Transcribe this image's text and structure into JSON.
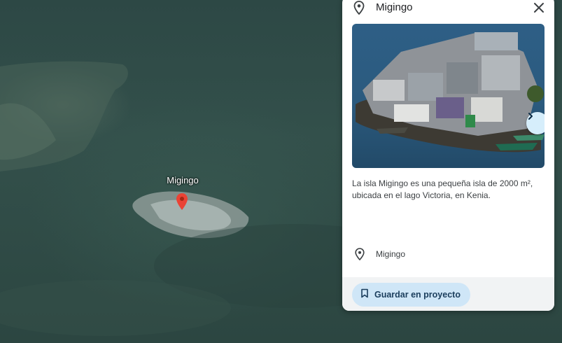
{
  "map": {
    "marker_label": "Migingo",
    "water_color": "#2f4a45"
  },
  "panel": {
    "title": "Migingo",
    "title_icon": "location-pin-icon",
    "close_icon": "close-icon",
    "photo_next_icon": "chevron-right-icon",
    "description": "La isla Migingo es una pequeña isla de 2000 m², ubicada en el lago Victoria, en Kenia.",
    "location_text": "Migingo",
    "save_button_label": "Guardar en proyecto",
    "save_icon": "bookmark-icon",
    "accent_color": "#cfe6f7"
  }
}
